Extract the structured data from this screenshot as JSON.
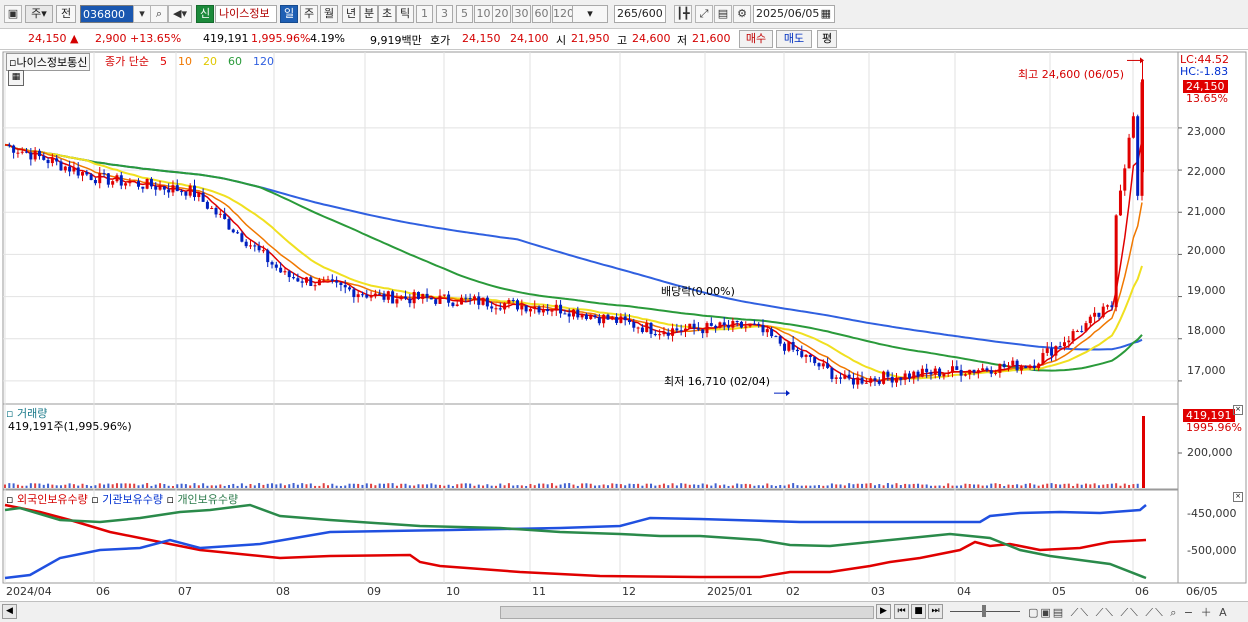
{
  "toolbar": {
    "period_select": "주",
    "prev_label": "전",
    "stock_code": "036800",
    "credit_label": "신",
    "stock_name": "나이스정보",
    "periods": [
      "일",
      "주",
      "월",
      "년",
      "분",
      "초",
      "틱"
    ],
    "minutes": [
      "1",
      "3",
      "5",
      "10",
      "20",
      "30",
      "60",
      "120"
    ],
    "count_value": "265",
    "count_total": "/600",
    "date_value": "2025/06/05"
  },
  "quote": {
    "price": "24,150",
    "arrow": "▲",
    "change": "2,900",
    "change_pct": "+13.65%",
    "volume": "419,191",
    "volume_pct": "1,995.96%",
    "turnover_pct": "4.19%",
    "amount": "9,919백만",
    "bid_label": "호가",
    "ask_price": "24,150",
    "bid_price": "24,100",
    "open_label": "시",
    "open": "21,950",
    "high_label": "고",
    "high": "24,600",
    "low_label": "저",
    "low": "21,600",
    "buy_button": "매수",
    "sell_button": "매도",
    "eval_button": "평"
  },
  "price_panel": {
    "title": "나이스정보통신",
    "ma_label": "종가 단순",
    "ma_periods": [
      "5",
      "10",
      "20",
      "60",
      "120"
    ],
    "lc": "LC:44.52",
    "hc": "HC:-1.83",
    "current_tag": "24,150",
    "current_pct": "13.65%",
    "high_annotation": "최고 24,600 (06/05)",
    "low_annotation": "최저 16,710 (02/04)",
    "dividend_annotation": "배당락(0.00%)",
    "y_ticks": [
      "23,000",
      "22,000",
      "21,000",
      "20,000",
      "19,000",
      "18,000",
      "17,000"
    ]
  },
  "volume_panel": {
    "title": "거래량",
    "value": "419,191주(1,995.96%)",
    "tag": "419,191",
    "tag_pct": "1995.96%",
    "y_ticks": [
      "200,000"
    ]
  },
  "holdings_panel": {
    "series_labels": [
      "외국인보유수량",
      "기관보유수량",
      "개인보유수량"
    ],
    "y_ticks": [
      "-450,000",
      "-500,000"
    ]
  },
  "x_axis": [
    "2024/04",
    "06",
    "07",
    "08",
    "09",
    "10",
    "11",
    "12",
    "2025/01",
    "02",
    "03",
    "04",
    "05",
    "06",
    "06/05"
  ],
  "chart_data": {
    "type": "line",
    "x": [
      "2024/04",
      "06",
      "07",
      "08",
      "09",
      "10",
      "11",
      "12",
      "2025/01",
      "02",
      "03",
      "04",
      "05",
      "06"
    ],
    "close_approx": [
      22600,
      21800,
      21500,
      19500,
      19000,
      18900,
      18700,
      18200,
      18300,
      17000,
      17200,
      17400,
      19000,
      24150
    ],
    "y_range": [
      16500,
      24800
    ],
    "high": {
      "value": 24600,
      "date": "06/05"
    },
    "low": {
      "value": 16710,
      "date": "02/04"
    },
    "colors": {
      "candle_up": "#e00000",
      "candle_down": "#0020c0",
      "ma5": "#e00000",
      "ma10": "#f07800",
      "ma20": "#f0e020",
      "ma60": "#2a9a3a",
      "ma120": "#3060e0",
      "foreign": "#e00000",
      "institution": "#2050e0",
      "individual": "#2a8a4a"
    }
  }
}
